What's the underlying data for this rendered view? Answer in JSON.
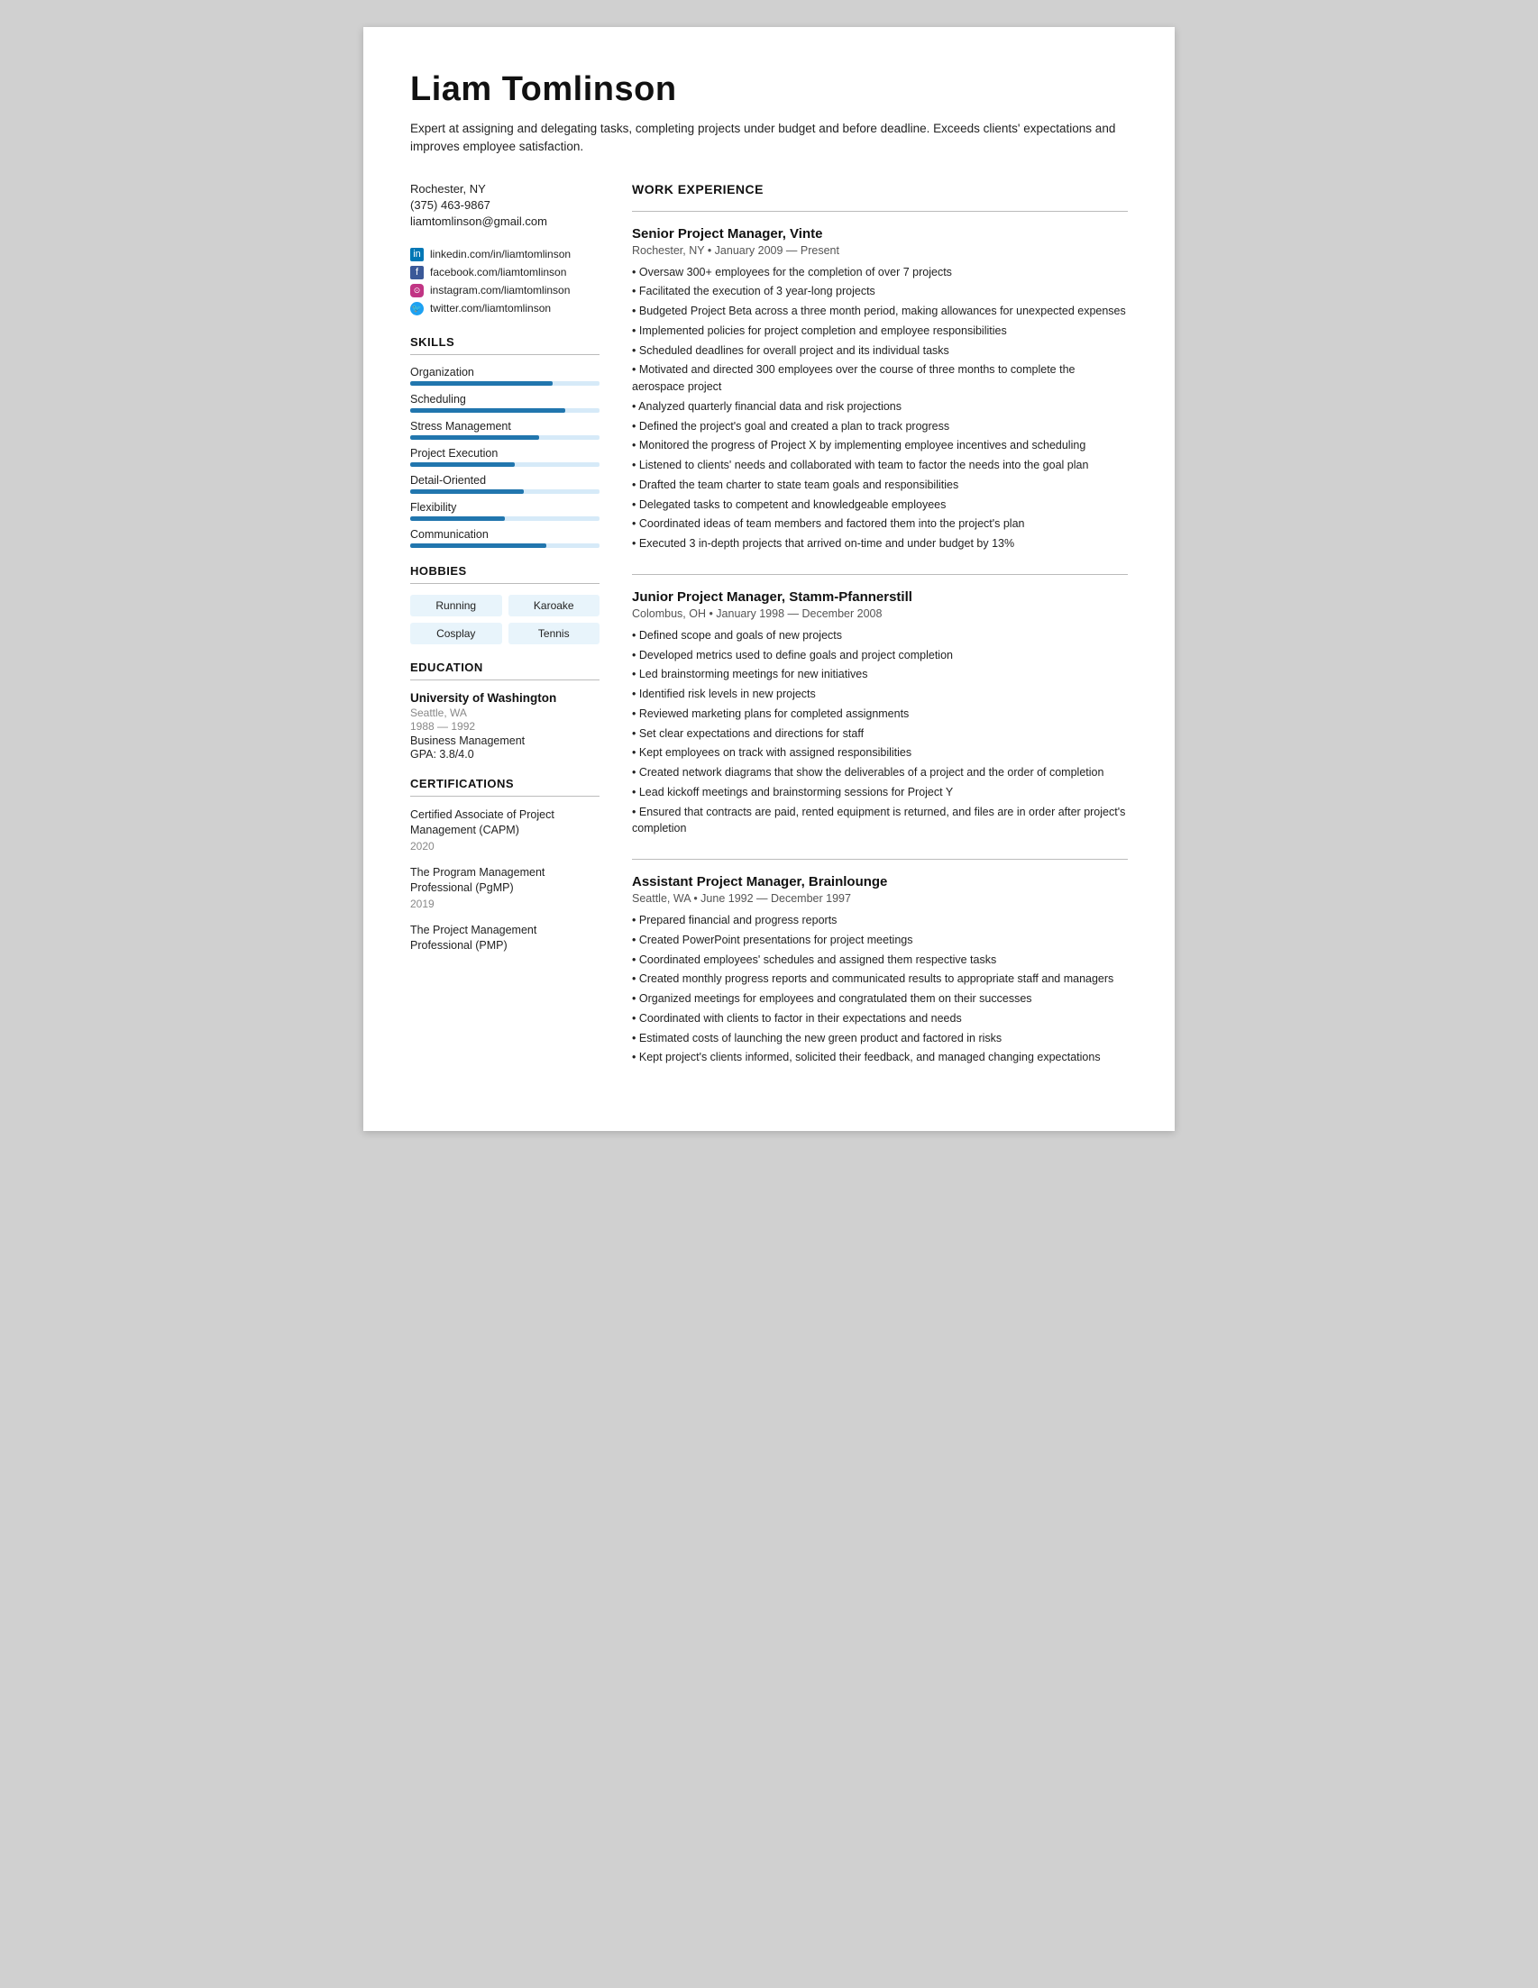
{
  "header": {
    "name": "Liam Tomlinson",
    "summary": "Expert at assigning and delegating tasks, completing projects under budget and before deadline. Exceeds clients' expectations and improves employee satisfaction."
  },
  "contact": {
    "location": "Rochester, NY",
    "phone": "(375) 463-9867",
    "email": "liamtomlinson@gmail.com"
  },
  "social": [
    {
      "platform": "linkedin",
      "label": "linkedin.com/in/liamtomlinson",
      "icon": "in"
    },
    {
      "platform": "facebook",
      "label": "facebook.com/liamtomlinson",
      "icon": "f"
    },
    {
      "platform": "instagram",
      "label": "instagram.com/liamtomlinson",
      "icon": "◎"
    },
    {
      "platform": "twitter",
      "label": "twitter.com/liamtomlinson",
      "icon": "🐦"
    }
  ],
  "sections": {
    "skills_title": "SKILLS",
    "hobbies_title": "HOBBIES",
    "education_title": "EDUCATION",
    "certifications_title": "CERTIFICATIONS",
    "work_experience_title": "WORK EXPERIENCE"
  },
  "skills": [
    {
      "name": "Organization",
      "pct": 75
    },
    {
      "name": "Scheduling",
      "pct": 82
    },
    {
      "name": "Stress Management",
      "pct": 68
    },
    {
      "name": "Project Execution",
      "pct": 55
    },
    {
      "name": "Detail-Oriented",
      "pct": 60
    },
    {
      "name": "Flexibility",
      "pct": 50
    },
    {
      "name": "Communication",
      "pct": 72
    }
  ],
  "hobbies": [
    "Running",
    "Karoake",
    "Cosplay",
    "Tennis"
  ],
  "education": [
    {
      "school": "University of Washington",
      "location": "Seattle, WA",
      "years": "1988 — 1992",
      "degree": "Business Management",
      "gpa": "GPA: 3.8/4.0"
    }
  ],
  "certifications": [
    {
      "name": "Certified Associate of Project Management (CAPM)",
      "year": "2020"
    },
    {
      "name": "The Program Management Professional (PgMP)",
      "year": "2019"
    },
    {
      "name": "The Project Management Professional (PMP)",
      "year": ""
    }
  ],
  "work_experience": [
    {
      "title": "Senior Project Manager, Vinte",
      "meta": "Rochester, NY • January 2009 — Present",
      "bullets": [
        "Oversaw 300+ employees for the completion of over 7 projects",
        "Facilitated the execution of 3 year-long projects",
        "Budgeted Project Beta across a three month period, making allowances for unexpected expenses",
        "Implemented policies for project completion and employee responsibilities",
        "Scheduled deadlines for overall project and its individual tasks",
        "Motivated and directed 300 employees over the course of three months to complete the aerospace project",
        "Analyzed quarterly financial data and risk projections",
        "Defined the project's goal and created a plan to track progress",
        "Monitored the progress of Project X by implementing employee incentives and scheduling",
        "Listened to clients' needs and collaborated with team to factor the needs into the goal plan",
        "Drafted the team charter to state team goals and responsibilities",
        "Delegated tasks to competent and knowledgeable employees",
        "Coordinated ideas of team members and factored them into the project's plan",
        "Executed 3 in-depth projects that arrived on-time and under budget by 13%"
      ]
    },
    {
      "title": "Junior Project Manager, Stamm-Pfannerstill",
      "meta": "Colombus, OH • January 1998 — December 2008",
      "bullets": [
        "Defined scope and goals of new projects",
        "Developed metrics used to define goals and project completion",
        "Led brainstorming meetings for new initiatives",
        "Identified risk levels in new projects",
        "Reviewed marketing plans for completed assignments",
        "Set clear expectations and directions for staff",
        "Kept employees on track with assigned responsibilities",
        "Created network diagrams that show the deliverables of a project and the order of completion",
        "Lead kickoff meetings and brainstorming sessions for Project Y",
        "Ensured that contracts are paid, rented equipment is returned, and files are in order after project's completion"
      ]
    },
    {
      "title": "Assistant Project Manager, Brainlounge",
      "meta": "Seattle, WA • June 1992 — December 1997",
      "bullets": [
        "Prepared financial and progress reports",
        "Created PowerPoint presentations for project meetings",
        "Coordinated employees' schedules and assigned them respective tasks",
        "Created monthly progress reports and communicated results to appropriate staff and managers",
        "Organized meetings for employees and congratulated them on their successes",
        "Coordinated with clients to factor in their expectations and needs",
        "Estimated costs of launching the new green product and factored in risks",
        "Kept project's clients informed, solicited their feedback, and managed changing expectations"
      ]
    }
  ]
}
